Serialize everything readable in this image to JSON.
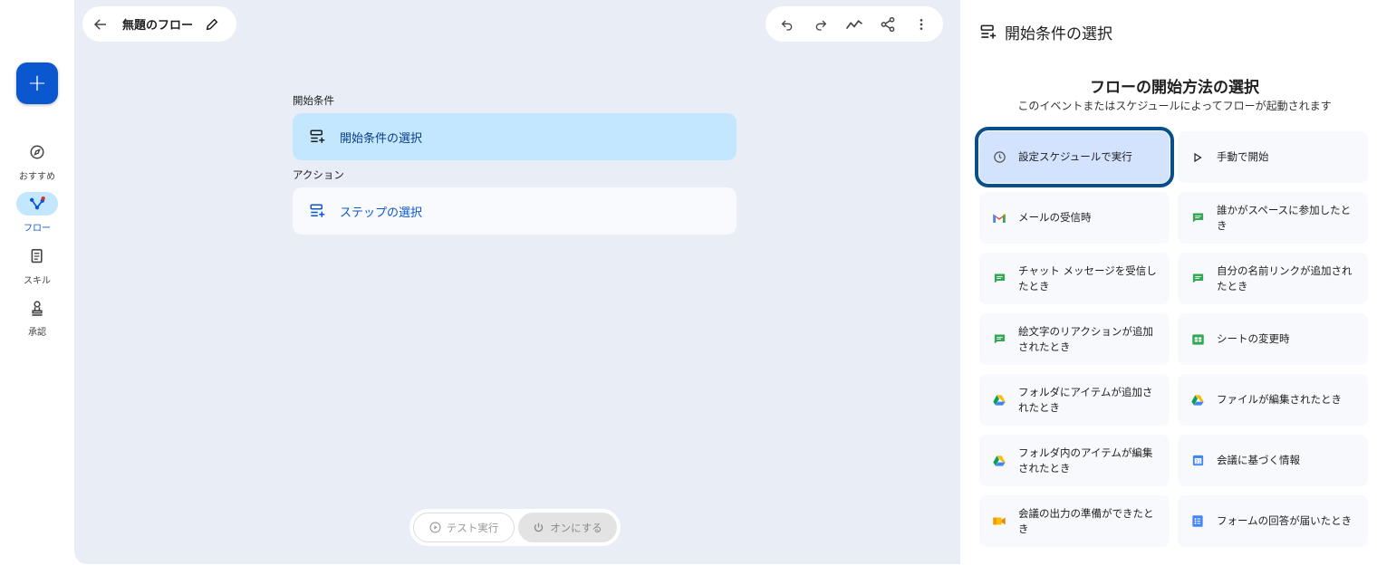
{
  "nav": {
    "create_label": "+",
    "items": [
      {
        "label": "おすすめ",
        "icon": "compass-icon"
      },
      {
        "label": "フロー",
        "icon": "flow-icon"
      },
      {
        "label": "スキル",
        "icon": "skill-icon"
      },
      {
        "label": "承認",
        "icon": "approval-icon"
      }
    ]
  },
  "header": {
    "title": "無題のフロー"
  },
  "canvas": {
    "trigger_section": "開始条件",
    "trigger_card": "開始条件の選択",
    "action_section": "アクション",
    "action_card": "ステップの選択"
  },
  "bottom": {
    "test_label": "テスト実行",
    "enable_label": "オンにする"
  },
  "panel": {
    "title": "開始条件の選択",
    "heading": "フローの開始方法の選択",
    "subheading": "このイベントまたはスケジュールによってフローが起動されます",
    "options": [
      {
        "label": "設定スケジュールで実行",
        "icon": "clock-icon",
        "selected": true
      },
      {
        "label": "手動で開始",
        "icon": "play-icon"
      },
      {
        "label": "メールの受信時",
        "icon": "gmail-icon"
      },
      {
        "label": "誰かがスペースに参加したとき",
        "icon": "chat-icon"
      },
      {
        "label": "チャット メッセージを受信したとき",
        "icon": "chat-icon"
      },
      {
        "label": "自分の名前リンクが追加されたとき",
        "icon": "chat-icon"
      },
      {
        "label": "絵文字のリアクションが追加されたとき",
        "icon": "chat-icon"
      },
      {
        "label": "シートの変更時",
        "icon": "sheets-icon"
      },
      {
        "label": "フォルダにアイテムが追加されたとき",
        "icon": "drive-icon"
      },
      {
        "label": "ファイルが編集されたとき",
        "icon": "drive-icon"
      },
      {
        "label": "フォルダ内のアイテムが編集されたとき",
        "icon": "drive-icon"
      },
      {
        "label": "会議に基づく情報",
        "icon": "calendar-icon"
      },
      {
        "label": "会議の出力の準備ができたとき",
        "icon": "meet-icon"
      },
      {
        "label": "フォームの回答が届いたとき",
        "icon": "forms-icon"
      }
    ]
  },
  "colors": {
    "accent": "#0b57d0",
    "canvas_bg": "#e8edf6",
    "selected_bg": "#c2e7ff",
    "selected_outline": "#0b4f8a"
  }
}
